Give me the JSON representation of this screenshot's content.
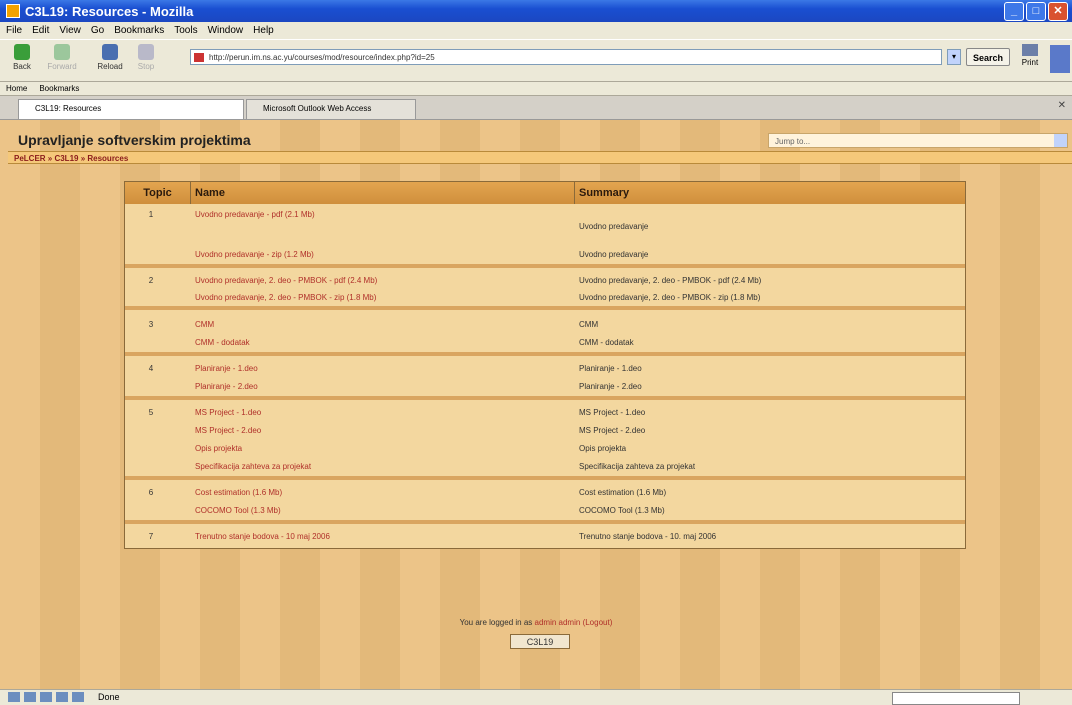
{
  "window": {
    "title": "C3L19: Resources - Mozilla"
  },
  "menu": [
    "File",
    "Edit",
    "View",
    "Go",
    "Bookmarks",
    "Tools",
    "Window",
    "Help"
  ],
  "nav": {
    "back": "Back",
    "forward": "Forward",
    "reload": "Reload",
    "stop": "Stop",
    "url": "http://perun.im.ns.ac.yu/courses/mod/resource/index.php?id=25",
    "search": "Search",
    "print": "Print"
  },
  "bookmarks": [
    "Home",
    "Bookmarks"
  ],
  "tabs": [
    {
      "label": "C3L19: Resources"
    },
    {
      "label": "Microsoft Outlook Web Access"
    }
  ],
  "page": {
    "title": "Upravljanje softverskim projektima",
    "jump": "Jump to...",
    "breadcrumb": "PeLCER » C3L19 » Resources"
  },
  "table": {
    "headers": [
      "Topic",
      "Name",
      "Summary"
    ],
    "rows": [
      {
        "topic": "1",
        "name": "Uvodno predavanje - pdf (2.1 Mb)",
        "summary": "Uvodno predavanje"
      },
      {
        "topic": "",
        "name": "Uvodno predavanje - zip (1.2 Mb)",
        "summary": "Uvodno predavanje"
      },
      {
        "topic": "2",
        "name": "Uvodno predavanje, 2. deo - PMBOK - pdf (2.4 Mb)",
        "summary": "Uvodno predavanje, 2. deo - PMBOK - pdf (2.4 Mb)"
      },
      {
        "topic": "",
        "name": "Uvodno predavanje, 2. deo - PMBOK - zip (1.8 Mb)",
        "summary": "Uvodno predavanje, 2. deo - PMBOK - zip (1.8 Mb)"
      },
      {
        "topic": "3",
        "name": "CMM",
        "summary": "CMM"
      },
      {
        "topic": "",
        "name": "CMM - dodatak",
        "summary": "CMM - dodatak"
      },
      {
        "topic": "4",
        "name": "Planiranje - 1.deo",
        "summary": "Planiranje - 1.deo"
      },
      {
        "topic": "",
        "name": "Planiranje - 2.deo",
        "summary": "Planiranje - 2.deo"
      },
      {
        "topic": "5",
        "name": "MS Project - 1.deo",
        "summary": "MS Project - 1.deo"
      },
      {
        "topic": "",
        "name": "MS Project - 2.deo",
        "summary": "MS Project - 2.deo"
      },
      {
        "topic": "",
        "name": "Opis projekta",
        "summary": "Opis projekta"
      },
      {
        "topic": "",
        "name": "Specifikacija zahteva za projekat",
        "summary": "Specifikacija zahteva za projekat"
      },
      {
        "topic": "6",
        "name": "Cost estimation (1.6 Mb)",
        "summary": "Cost estimation (1.6 Mb)"
      },
      {
        "topic": "",
        "name": "COCOMO Tool (1.3 Mb)",
        "summary": "COCOMO Tool (1.3 Mb)"
      },
      {
        "topic": "7",
        "name": "Trenutno stanje bodova - 10 maj 2006",
        "summary": "Trenutno stanje bodova - 10. maj 2006"
      }
    ]
  },
  "footer": {
    "logged_prefix": "You are logged in as",
    "user": "admin admin",
    "logout": "(Logout)",
    "course_button": "C3L19"
  },
  "status": {
    "text": "Done"
  }
}
